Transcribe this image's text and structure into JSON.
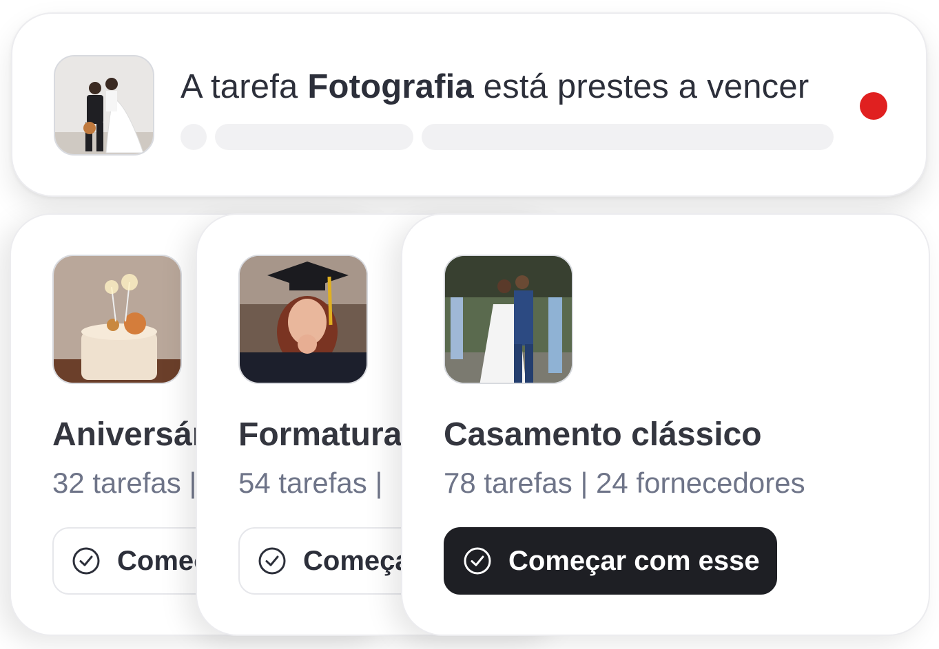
{
  "notification": {
    "prefix": "A tarefa ",
    "task": "Fotografia",
    "suffix": " está prestes a vencer",
    "status_color": "#e02020"
  },
  "templates": [
    {
      "title": "Aniversário",
      "tasks": "32 tarefas",
      "separator": " | ",
      "vendors": "",
      "cta": "Começar com esse"
    },
    {
      "title": "Formatura",
      "tasks": "54 tarefas",
      "separator": " | ",
      "vendors": "",
      "cta": "Começar com esse"
    },
    {
      "title": "Casamento clássico",
      "tasks": "78 tarefas",
      "separator": " | ",
      "vendors": "24 fornecedores",
      "cta": "Começar com esse"
    }
  ],
  "icons": {
    "check": "check-circle-icon",
    "status": "red-dot-icon"
  }
}
